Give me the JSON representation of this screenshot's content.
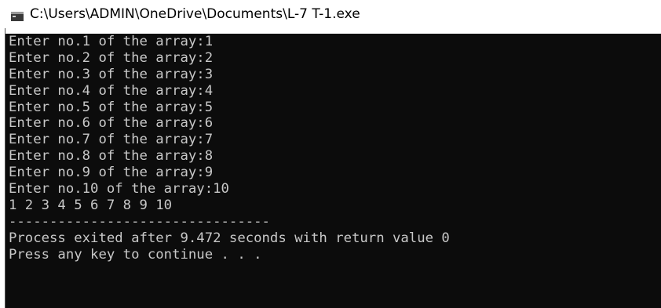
{
  "window": {
    "title": "C:\\Users\\ADMIN\\OneDrive\\Documents\\L-7 T-1.exe",
    "icon": "console-app-icon"
  },
  "console": {
    "lines": [
      "Enter no.1 of the array:1",
      "Enter no.2 of the array:2",
      "Enter no.3 of the array:3",
      "Enter no.4 of the array:4",
      "Enter no.5 of the array:5",
      "Enter no.6 of the array:6",
      "Enter no.7 of the array:7",
      "Enter no.8 of the array:8",
      "Enter no.9 of the array:9",
      "Enter no.10 of the array:10",
      "1 2 3 4 5 6 7 8 9 10",
      "--------------------------------",
      "Process exited after 9.472 seconds with return value 0",
      "Press any key to continue . . ."
    ],
    "background": "#0c0c0c",
    "foreground": "#c8c8c8"
  }
}
